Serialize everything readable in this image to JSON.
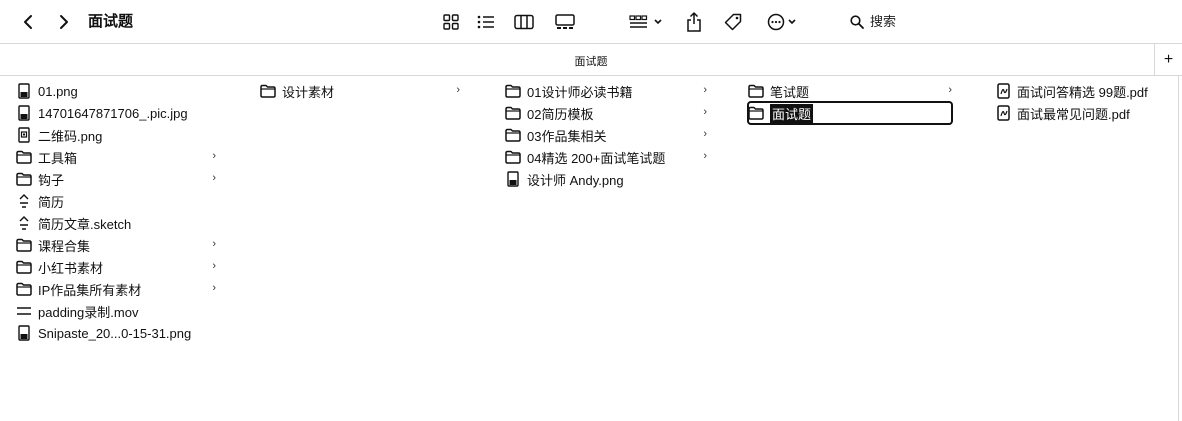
{
  "toolbar": {
    "title": "面试题",
    "search_label": "搜索"
  },
  "tab": {
    "title": "面试题",
    "new_tab_label": "+"
  },
  "columns": [
    {
      "items": [
        {
          "label": "01.png",
          "icon": "image-file-icon",
          "has_children": false
        },
        {
          "label": "14701647871706_.pic.jpg",
          "icon": "image-file-icon",
          "has_children": false
        },
        {
          "label": "二维码.png",
          "icon": "qr-image-icon",
          "has_children": false
        },
        {
          "label": "工具箱",
          "icon": "folder-icon",
          "has_children": true
        },
        {
          "label": "钩子",
          "icon": "folder-icon",
          "has_children": true
        },
        {
          "label": "简历",
          "icon": "sketch-file-icon",
          "has_children": false
        },
        {
          "label": "简历文章.sketch",
          "icon": "sketch-file-icon",
          "has_children": false
        },
        {
          "label": "课程合集",
          "icon": "folder-icon",
          "has_children": true
        },
        {
          "label": "小红书素材",
          "icon": "folder-icon",
          "has_children": true
        },
        {
          "label": "IP作品集所有素材",
          "icon": "folder-icon",
          "has_children": true
        },
        {
          "label": "padding录制.mov",
          "icon": "movie-file-icon",
          "has_children": false
        },
        {
          "label": "Snipaste_20...0-15-31.png",
          "icon": "image-file-icon",
          "has_children": false
        }
      ]
    },
    {
      "items": [
        {
          "label": "设计素材",
          "icon": "folder-icon",
          "has_children": true
        }
      ]
    },
    {
      "items": [
        {
          "label": "01设计师必读书籍",
          "icon": "folder-icon",
          "has_children": true
        },
        {
          "label": "02简历模板",
          "icon": "folder-icon",
          "has_children": true
        },
        {
          "label": "03作品集相关",
          "icon": "folder-icon",
          "has_children": true
        },
        {
          "label": "04精选 200+面试笔试题",
          "icon": "folder-icon",
          "has_children": true
        },
        {
          "label": "设计师 Andy.png",
          "icon": "image-file-icon",
          "has_children": false
        }
      ]
    },
    {
      "items": [
        {
          "label": "笔试题",
          "icon": "folder-icon",
          "has_children": true
        },
        {
          "label": "面试题",
          "icon": "folder-icon",
          "has_children": false,
          "selected": true
        }
      ]
    },
    {
      "items": [
        {
          "label": "面试问答精选 99题.pdf",
          "icon": "pdf-file-icon",
          "has_children": false
        },
        {
          "label": "面试最常见问题.pdf",
          "icon": "pdf-file-icon",
          "has_children": false
        }
      ]
    }
  ]
}
